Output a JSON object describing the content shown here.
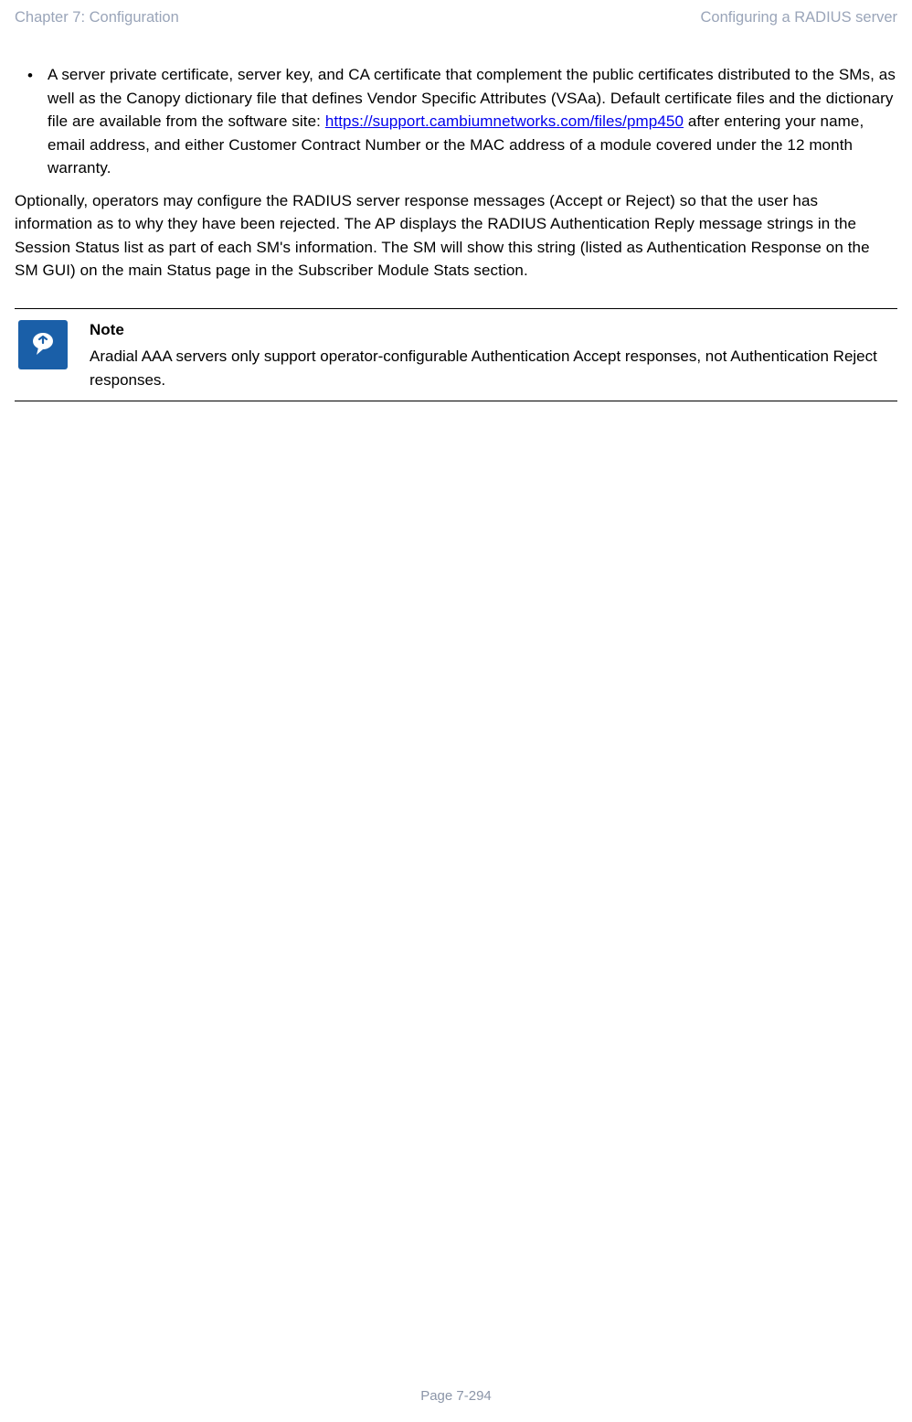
{
  "header": {
    "left": "Chapter 7:  Configuration",
    "right": "Configuring a RADIUS server"
  },
  "bullet": {
    "text_before_link": "A server private certificate, server key, and CA certificate that complement the public certificates distributed to the SMs, as well as the Canopy dictionary file that defines Vendor Specific Attributes (VSAa). Default certificate files and the dictionary file are available from the software site: ",
    "link_text": "https://support.cambiumnetworks.com/files/pmp450",
    "text_after_link": " after entering your name, email address, and either Customer Contract Number or the MAC address of a module covered under the 12 month warranty."
  },
  "paragraph": "Optionally, operators may configure the RADIUS server response messages (Accept or Reject) so that the user has information as to why they have been rejected. The AP displays the RADIUS Authentication Reply message strings in the Session Status list as part of each SM's information. The SM will show this string (listed as Authentication Response on the SM GUI) on the main Status page in the Subscriber Module Stats section.",
  "note": {
    "title": "Note",
    "body": "Aradial AAA servers only support operator-configurable Authentication Accept responses, not Authentication Reject responses."
  },
  "footer": "Page 7-294"
}
